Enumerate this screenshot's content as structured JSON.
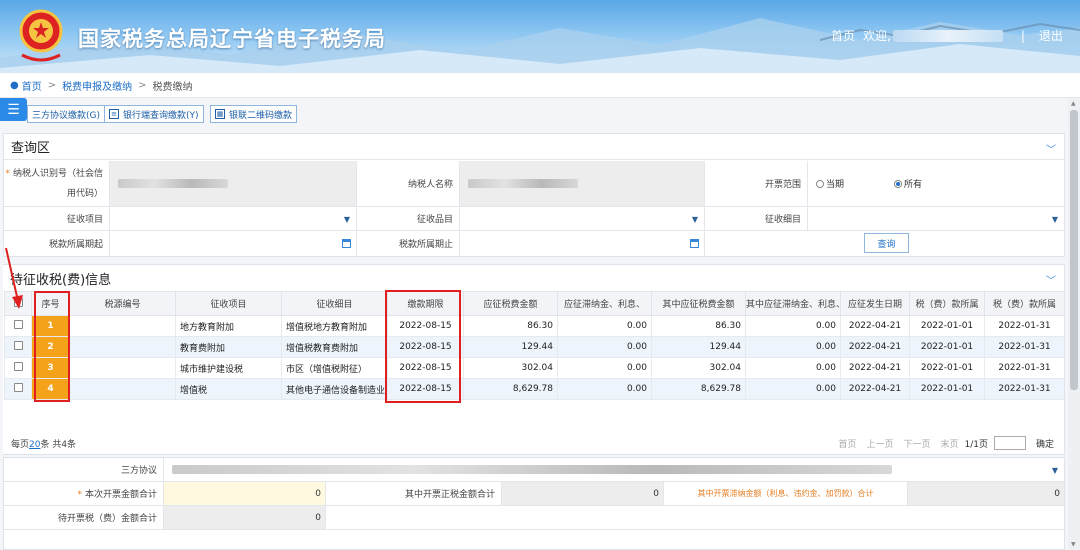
{
  "header": {
    "site_title": "国家税务总局辽宁省电子税务局",
    "nav_home": "首页",
    "nav_welcome": "欢迎,",
    "nav_sep": "|",
    "nav_logout": "退出"
  },
  "breadcrumb": {
    "items": [
      "首页",
      "税费申报及缴纳",
      "税费缴纳"
    ],
    "sep": ">"
  },
  "toolbar": {
    "buttons": [
      "三方协议缴款(G)",
      "银行端查询缴款(Y)",
      "银联二维码缴款"
    ]
  },
  "query": {
    "title": "查询区",
    "taxpayer_id_label": "纳税人识别号（社会信用代码）",
    "taxpayer_name_label": "纳税人名称",
    "invoice_scope_label": "开票范围",
    "invoice_scope_options": [
      "当期",
      "所有"
    ],
    "invoice_scope_selected": "所有",
    "levy_item_label": "征收项目",
    "levy_category_label": "征收品目",
    "levy_subitem_label": "征收细目",
    "period_start_label": "税款所属期起",
    "period_end_label": "税款所属期止",
    "query_button": "查询"
  },
  "pending": {
    "title": "待征收税(费)信息",
    "columns": [
      "序号",
      "税源编号",
      "征收项目",
      "征收细目",
      "缴款期限",
      "应征税费金额",
      "应征滞纳金、利息、",
      "其中应征税费金额",
      "其中应征滞纳金、利息、",
      "应征发生日期",
      "税（费）款所属",
      "税（费）款所属"
    ],
    "rows": [
      {
        "seq": "1",
        "source_no": "",
        "item": "地方教育附加",
        "subitem": "增值税地方教育附加",
        "deadline": "2022-08-15",
        "amount": "86.30",
        "late_fee": "0.00",
        "of_amount": "86.30",
        "of_late_fee": "0.00",
        "occur_date": "2022-04-21",
        "period_from": "2022-01-01",
        "period_to": "2022-01-31"
      },
      {
        "seq": "2",
        "source_no": "",
        "item": "教育费附加",
        "subitem": "增值税教育费附加",
        "deadline": "2022-08-15",
        "amount": "129.44",
        "late_fee": "0.00",
        "of_amount": "129.44",
        "of_late_fee": "0.00",
        "occur_date": "2022-04-21",
        "period_from": "2022-01-01",
        "period_to": "2022-01-31"
      },
      {
        "seq": "3",
        "source_no": "",
        "item": "城市维护建设税",
        "subitem": "市区（增值税附征）",
        "deadline": "2022-08-15",
        "amount": "302.04",
        "late_fee": "0.00",
        "of_amount": "302.04",
        "of_late_fee": "0.00",
        "occur_date": "2022-04-21",
        "period_from": "2022-01-01",
        "period_to": "2022-01-31"
      },
      {
        "seq": "4",
        "source_no": "",
        "item": "增值税",
        "subitem": "其他电子通信设备制造业",
        "deadline": "2022-08-15",
        "amount": "8,629.78",
        "late_fee": "0.00",
        "of_amount": "8,629.78",
        "of_late_fee": "0.00",
        "occur_date": "2022-04-21",
        "period_from": "2022-01-01",
        "period_to": "2022-01-31"
      }
    ],
    "pager": {
      "per_page_prefix": "每页",
      "per_page": "20",
      "per_page_suffix": "条 共4条",
      "first": "首页",
      "prev": "上一页",
      "next": "下一页",
      "last": "末页",
      "page_info": "1/1页",
      "confirm": "确定"
    }
  },
  "summary": {
    "agreement_label": "三方协议",
    "invoice_total_label": "本次开票金额合计",
    "invoice_total_value": "0",
    "of_tax_total_label": "其中开票正税金额合计",
    "of_tax_total_value": "0",
    "of_late_total_label": "其中开票滞纳金额（利息、违约金、加罚款）合计",
    "of_late_total_value": "0",
    "pending_total_label": "待开票税（费）金额合计",
    "pending_total_value": "0"
  },
  "colors": {
    "header_blue": "#5aa7e6",
    "accent": "#1e6fc5",
    "seq_orange": "#f5a21b",
    "highlight_red": "#e02020"
  }
}
